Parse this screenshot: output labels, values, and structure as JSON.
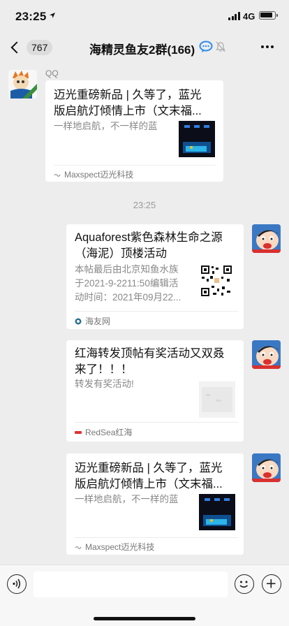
{
  "status_bar": {
    "time": "23:25",
    "network": "4G",
    "battery_level": 0.8
  },
  "nav": {
    "unread_count": "767",
    "title": "海精灵鱼友2群(166)",
    "icons": [
      "back-chevron-icon",
      "chat-bubble-icon",
      "mute-bell-icon",
      "more-icon"
    ]
  },
  "messages": [
    {
      "sender": "QQ",
      "side": "left",
      "title": "迈光重磅新品 | 久等了，蓝光版启航灯倾情上市（文末福...",
      "title_l1": "迈光重磅新品 | 久等了，蓝光",
      "title_l2": "版启航灯倾情上市（文末福...",
      "desc": "一样地启航，不一样的蓝",
      "source": "Maxspect迈光科技",
      "thumb": "aquarium-light-thumbnail"
    },
    {
      "side": "right",
      "title_l1": "Aquaforest紫色森林生命之源",
      "title_l2": "（海泥）顶楼活动",
      "desc_l1": "本帖最后由北京知鱼水族",
      "desc_l2": "于2021-9-2211:50编辑活",
      "desc_l3": "动时间：2021年09月22...",
      "source": "海友网",
      "thumb": "qr-code-thumbnail"
    },
    {
      "side": "right",
      "title_l1": "红海转发顶帖有奖活动又双叒",
      "title_l2": "来了！！！",
      "desc": "转发有奖活动!",
      "source": "RedSea红海",
      "thumb": "dark-photo-thumbnail"
    },
    {
      "side": "right",
      "title_l1": "迈光重磅新品 | 久等了，蓝光",
      "title_l2": "版启航灯倾情上市（文末福...",
      "desc": "一样地启航，不一样的蓝",
      "source": "Maxspect迈光科技",
      "thumb": "aquarium-light-thumbnail"
    }
  ],
  "timestamp": "23:25",
  "input_bar": {
    "placeholder": "",
    "icons": [
      "voice-icon",
      "emoji-icon",
      "plus-icon"
    ]
  },
  "colors": {
    "background": "#ededed",
    "card": "#ffffff",
    "muted_text": "#888888"
  }
}
